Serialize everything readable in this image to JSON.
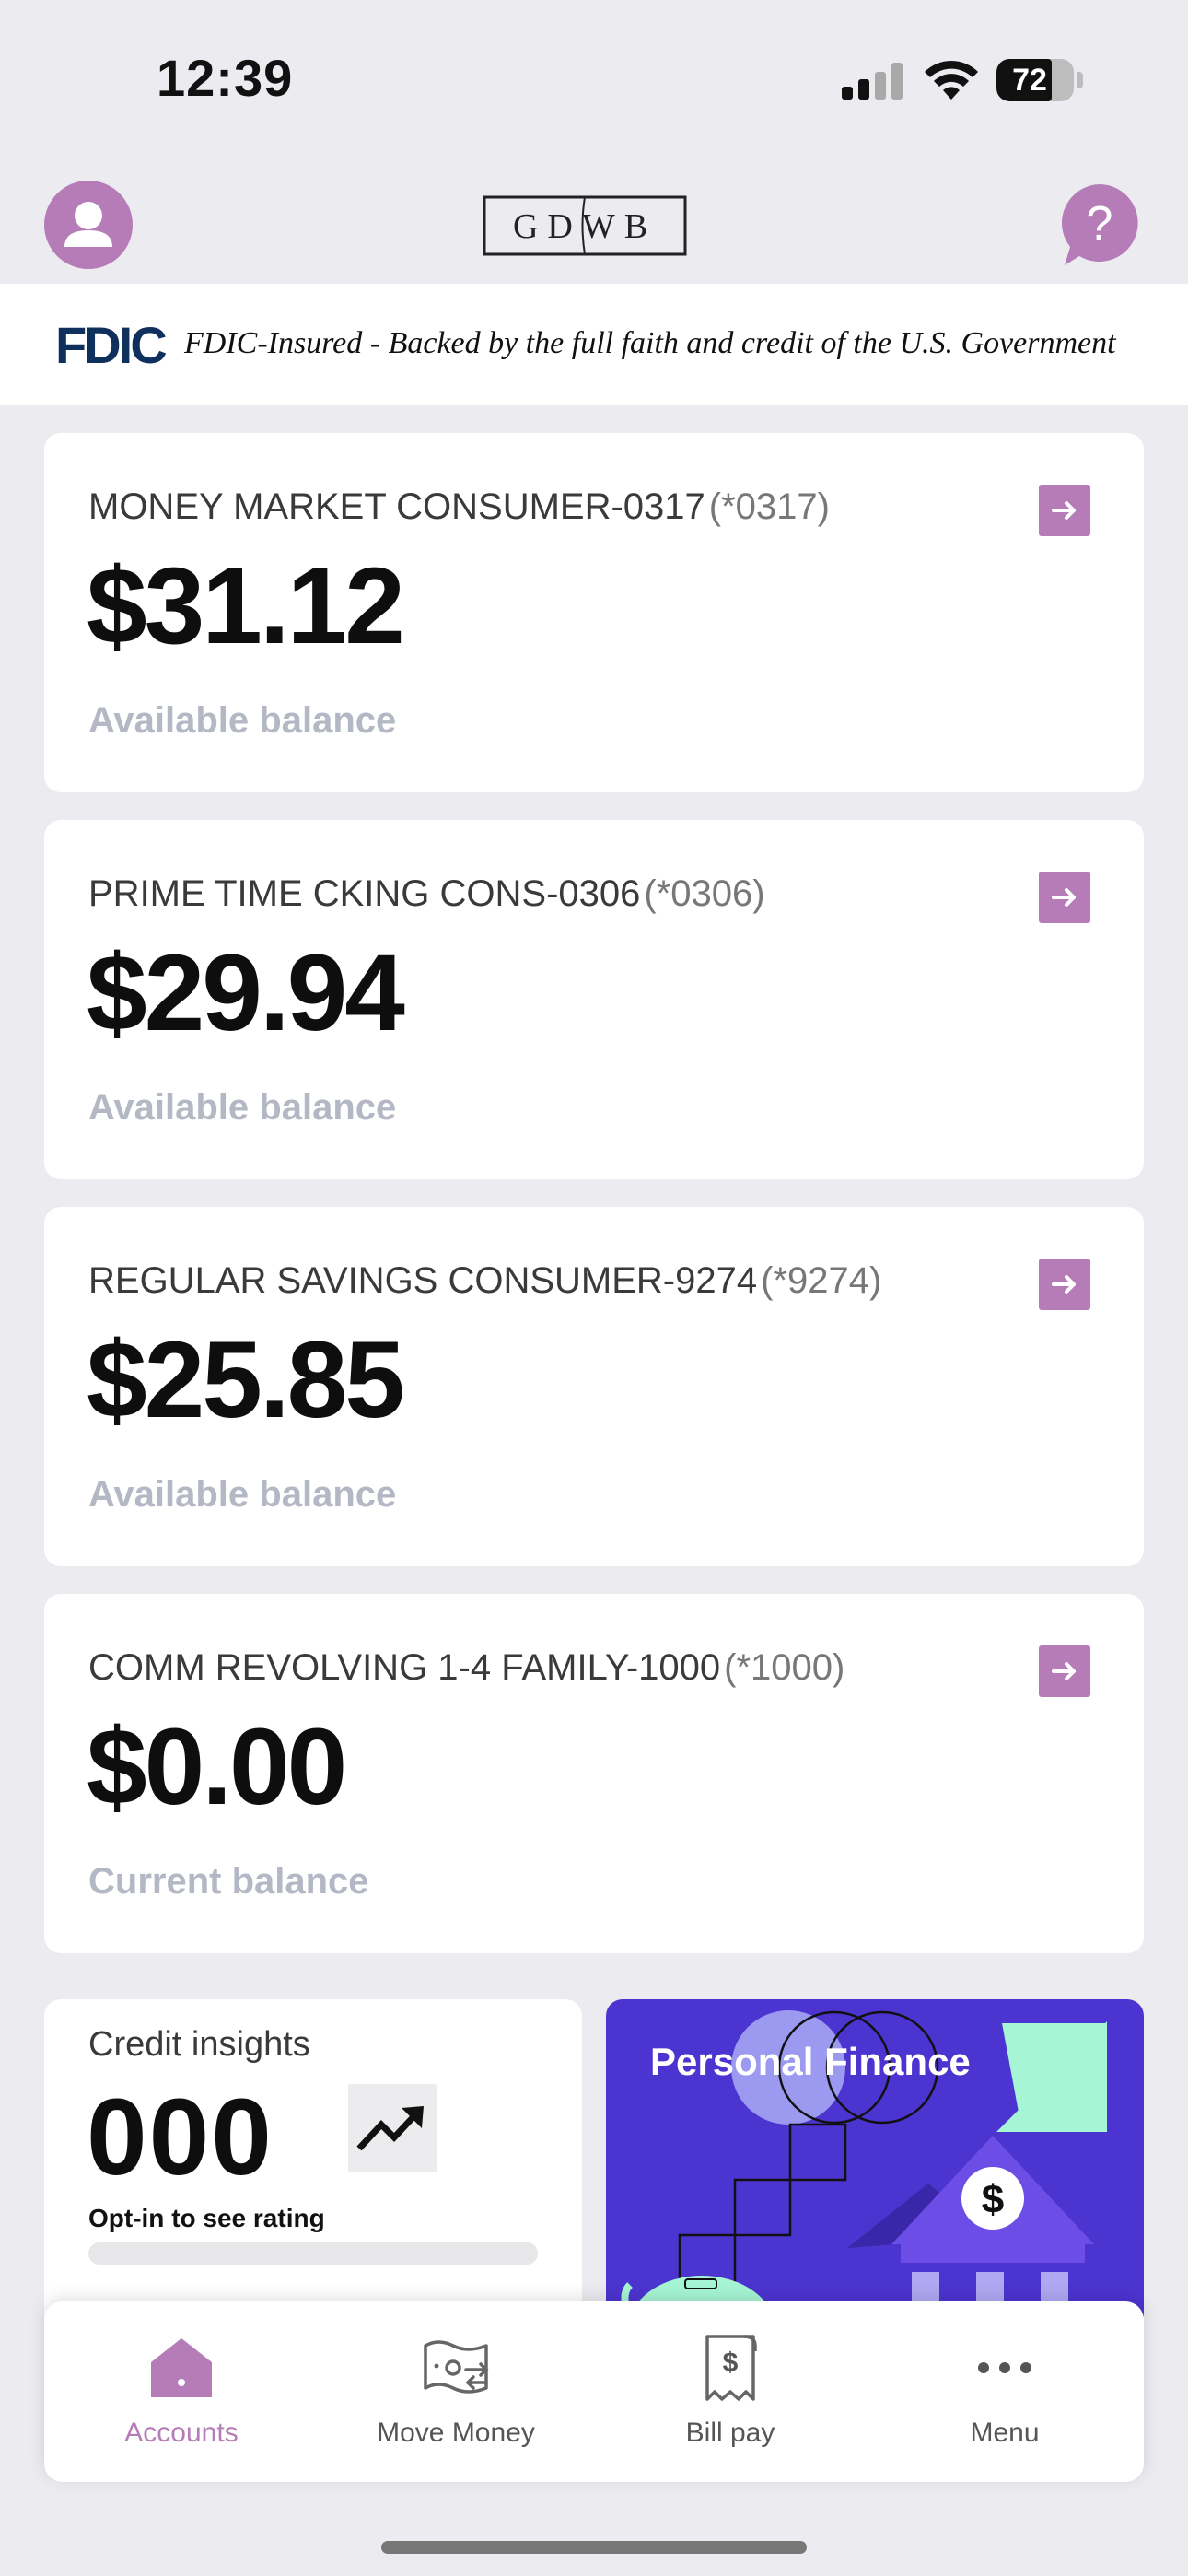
{
  "status_bar": {
    "time": "12:39",
    "battery": "72",
    "battery_level": 0.72
  },
  "header": {
    "logo_text": "GDWB",
    "avatar_icon": "person-icon",
    "help_icon": "question-icon"
  },
  "fdic": {
    "logo": "FDIC",
    "text": "FDIC-Insured - Backed by the full faith and credit of the U.S. Government"
  },
  "accounts": [
    {
      "name": "MONEY MARKET CONSUMER-0317",
      "mask": "(*0317)",
      "amount": "$31.12",
      "label": "Available balance"
    },
    {
      "name": "PRIME TIME CKING CONS-0306",
      "mask": "(*0306)",
      "amount": "$29.94",
      "label": "Available balance"
    },
    {
      "name": "REGULAR SAVINGS CONSUMER-9274",
      "mask": "(*9274)",
      "amount": "$25.85",
      "label": "Available balance"
    },
    {
      "name": "COMM REVOLVING 1-4 FAMILY-1000",
      "mask": "(*1000)",
      "amount": "$0.00",
      "label": "Current balance"
    }
  ],
  "credit": {
    "title": "Credit insights",
    "score": "000",
    "optin": "Opt-in to see rating",
    "icon": "trending-up-icon"
  },
  "personal_finance": {
    "title": "Personal Finance",
    "icon": "bank-dollar-icon"
  },
  "nav": [
    {
      "label": "Accounts",
      "icon": "home-icon",
      "active": true
    },
    {
      "label": "Move Money",
      "icon": "money-transfer-icon",
      "active": false
    },
    {
      "label": "Bill pay",
      "icon": "receipt-dollar-icon",
      "active": false
    },
    {
      "label": "Menu",
      "icon": "more-dots-icon",
      "active": false
    }
  ],
  "colors": {
    "accent": "#b57cb8",
    "background": "#ebebf0",
    "pf_background": "#4c34d0",
    "pf_mint": "#a6f5d4",
    "muted": "#b4b8c4"
  }
}
